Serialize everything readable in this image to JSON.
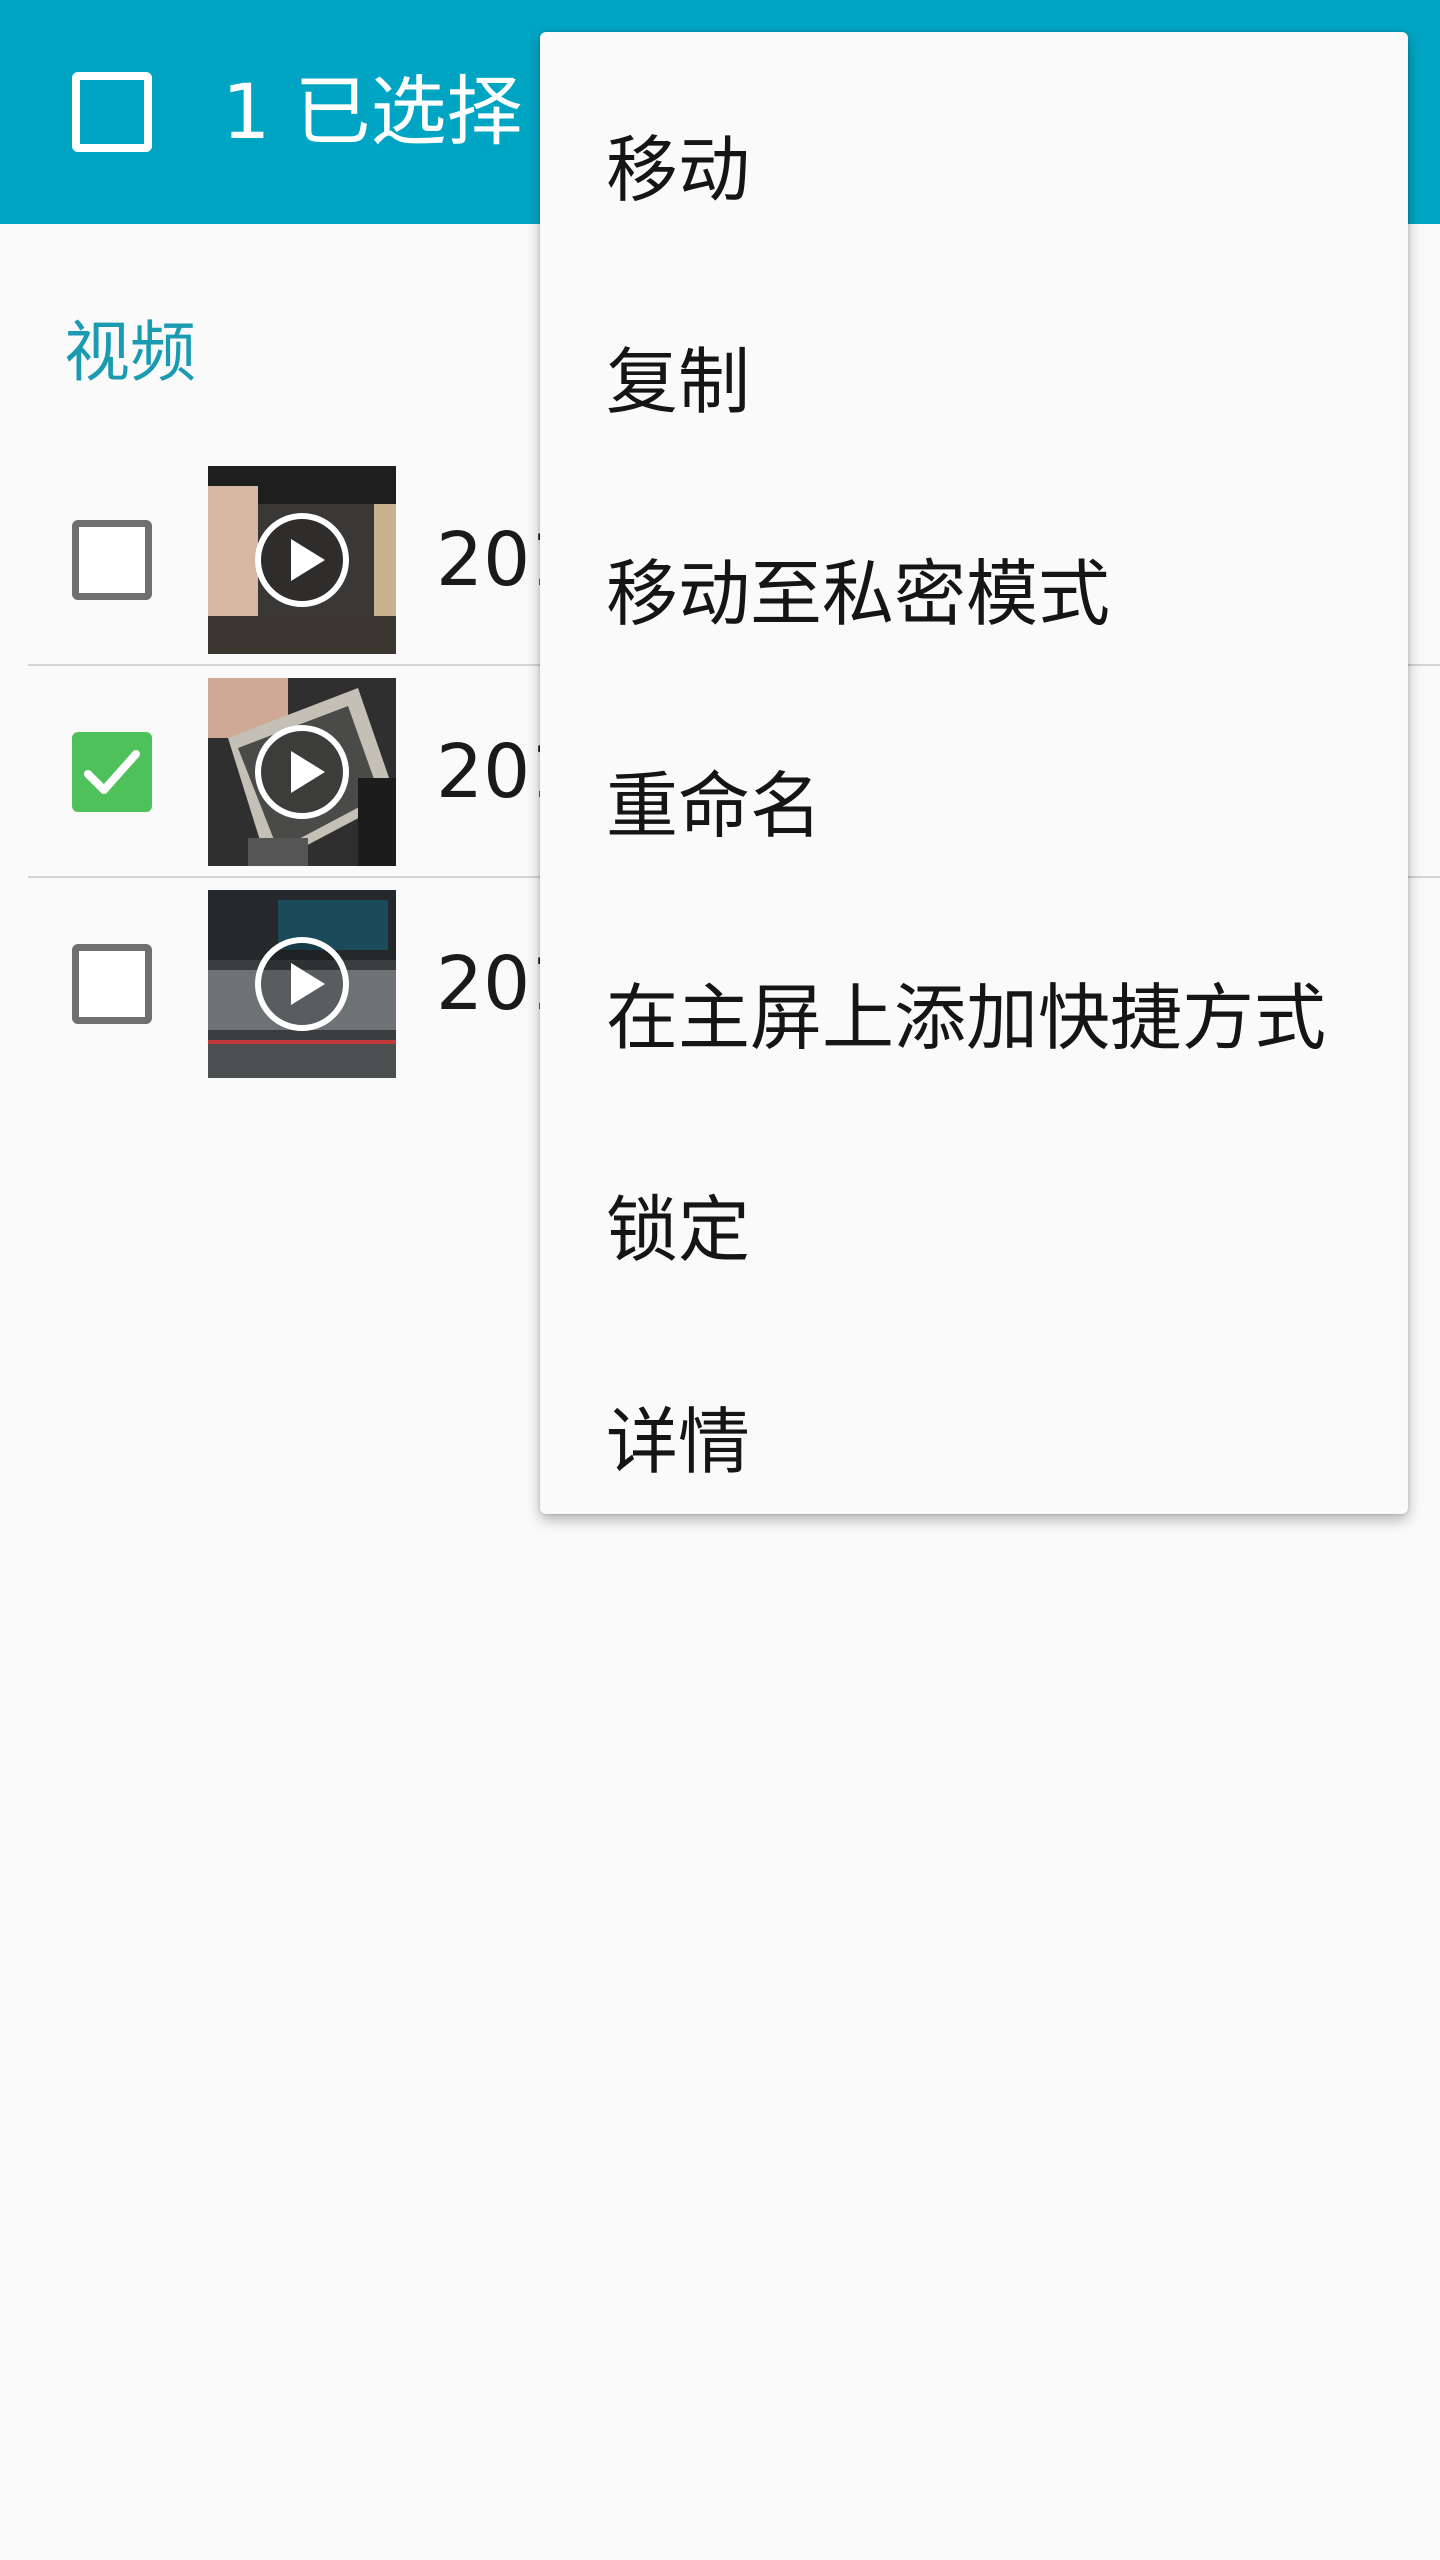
{
  "header": {
    "title": "1 已选择"
  },
  "section": {
    "title": "视频"
  },
  "items": [
    {
      "name": "201",
      "checked": false
    },
    {
      "name": "201",
      "checked": true
    },
    {
      "name": "201",
      "checked": false
    }
  ],
  "menu": {
    "items": [
      {
        "label": "移动"
      },
      {
        "label": "复制"
      },
      {
        "label": "移动至私密模式"
      },
      {
        "label": "重命名"
      },
      {
        "label": "在主屏上添加快捷方式"
      },
      {
        "label": "锁定"
      },
      {
        "label": "详情"
      }
    ]
  },
  "colors": {
    "appbar": "#00a5c4",
    "section_header": "#1b9bb1",
    "checkbox_checked": "#4fc15a"
  }
}
